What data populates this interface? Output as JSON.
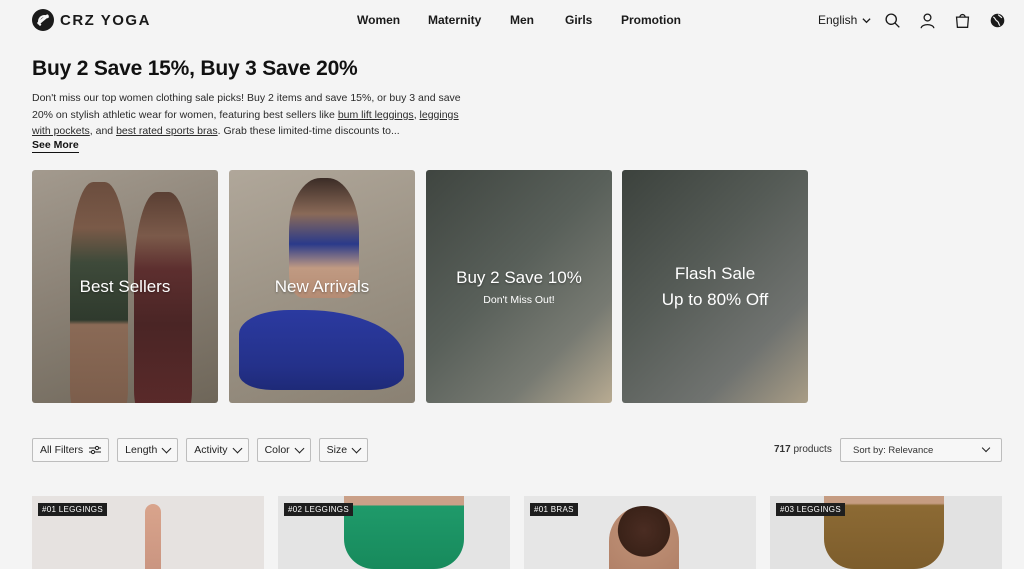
{
  "brand": {
    "name": "CRZ YOGA"
  },
  "nav": {
    "items": [
      "Women",
      "Maternity",
      "Men",
      "Girls",
      "Promotion"
    ]
  },
  "header": {
    "language": "English"
  },
  "intro": {
    "title": "Buy 2 Save 15%, Buy 3 Save 20%",
    "desc_1": "Don't miss our top women clothing sale picks! Buy 2 items and save 15%, or buy 3 and save 20% on stylish athletic wear for women, featuring best sellers like ",
    "link_1": "bum lift leggings",
    "desc_2": ", ",
    "link_2": "leggings with pockets",
    "desc_3": ", and ",
    "link_3": "best rated sports bras",
    "desc_4": ". Grab these limited-time discounts to...",
    "see_more": "See More"
  },
  "banners": [
    {
      "label": "Best Sellers"
    },
    {
      "label": "New Arrivals"
    },
    {
      "label": "Buy 2 Save 10%",
      "sub": "Don't Miss Out!"
    },
    {
      "line1": "Flash Sale",
      "line2": "Up to 80% Off"
    }
  ],
  "filters": {
    "all_filters": "All Filters",
    "items": [
      "Length",
      "Activity",
      "Color",
      "Size"
    ]
  },
  "results": {
    "count": "717",
    "count_suffix": " products",
    "sort": "Sort by: Relevance"
  },
  "products": [
    {
      "tag": "#01 LEGGINGS"
    },
    {
      "tag": "#02 LEGGINGS"
    },
    {
      "tag": "#01 BRAS"
    },
    {
      "tag": "#03 LEGGINGS"
    }
  ],
  "colors": {
    "text": "#1a1a1a",
    "background": "#f4f4f4",
    "tag_bg": "#1e1e1e"
  },
  "icons": [
    "search-icon",
    "user-icon",
    "bag-icon",
    "globe-icon",
    "filter-sliders-icon",
    "chevron-down-icon"
  ]
}
